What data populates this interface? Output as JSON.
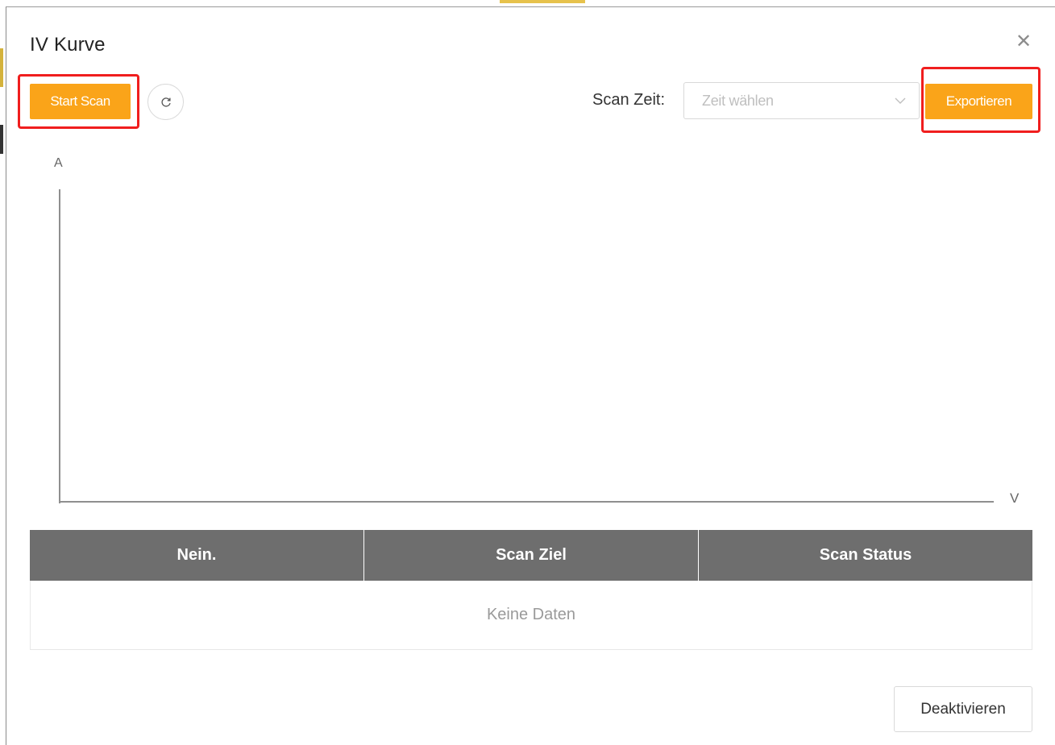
{
  "dialog": {
    "title": "IV Kurve",
    "close_icon": "close-icon"
  },
  "toolbar": {
    "start_scan_label": "Start Scan",
    "refresh_icon": "refresh-icon",
    "scan_time_label": "Scan Zeit:",
    "scan_time_placeholder": "Zeit wählen",
    "export_label": "Exportieren",
    "accent_color": "#faa419",
    "highlight_color": "#f01e1e"
  },
  "chart": {
    "y_axis_label": "A",
    "x_axis_label": "V"
  },
  "chart_data": {
    "type": "line",
    "xlabel": "V",
    "ylabel": "A",
    "series": []
  },
  "table": {
    "columns": [
      "Nein.",
      "Scan Ziel",
      "Scan Status"
    ],
    "rows": [],
    "empty_text": "Keine Daten",
    "header_color": "#6e6e6e"
  },
  "footer": {
    "deactivate_label": "Deaktivieren"
  }
}
